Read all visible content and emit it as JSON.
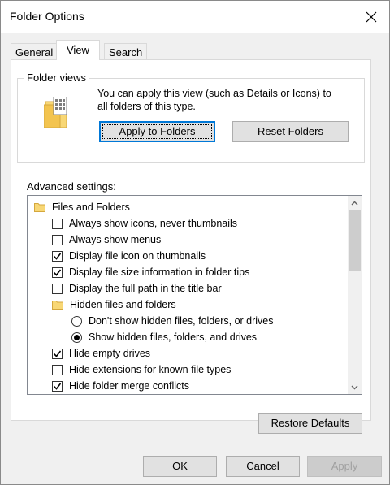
{
  "window": {
    "title": "Folder Options"
  },
  "tabs": [
    {
      "label": "General",
      "active": false
    },
    {
      "label": "View",
      "active": true
    },
    {
      "label": "Search",
      "active": false
    }
  ],
  "folder_views": {
    "legend": "Folder views",
    "description_line1": "You can apply this view (such as Details or Icons) to",
    "description_line2": "all folders of this type.",
    "apply_button": "Apply to Folders",
    "reset_button": "Reset Folders"
  },
  "advanced": {
    "label": "Advanced settings:",
    "items": [
      {
        "type": "folder",
        "label": "Files and Folders",
        "indent": 0
      },
      {
        "type": "checkbox",
        "label": "Always show icons, never thumbnails",
        "checked": false,
        "indent": 1
      },
      {
        "type": "checkbox",
        "label": "Always show menus",
        "checked": false,
        "indent": 1
      },
      {
        "type": "checkbox",
        "label": "Display file icon on thumbnails",
        "checked": true,
        "indent": 1
      },
      {
        "type": "checkbox",
        "label": "Display file size information in folder tips",
        "checked": true,
        "indent": 1
      },
      {
        "type": "checkbox",
        "label": "Display the full path in the title bar",
        "checked": false,
        "indent": 1
      },
      {
        "type": "folder",
        "label": "Hidden files and folders",
        "indent": 1
      },
      {
        "type": "radio",
        "label": "Don't show hidden files, folders, or drives",
        "checked": false,
        "indent": 2
      },
      {
        "type": "radio",
        "label": "Show hidden files, folders, and drives",
        "checked": true,
        "indent": 2
      },
      {
        "type": "checkbox",
        "label": "Hide empty drives",
        "checked": true,
        "indent": 1
      },
      {
        "type": "checkbox",
        "label": "Hide extensions for known file types",
        "checked": false,
        "indent": 1
      },
      {
        "type": "checkbox",
        "label": "Hide folder merge conflicts",
        "checked": true,
        "indent": 1
      }
    ]
  },
  "restore_defaults": "Restore Defaults",
  "footer": {
    "ok": "OK",
    "cancel": "Cancel",
    "apply": "Apply"
  },
  "colors": {
    "focus_border": "#0078d7",
    "folder_yellow": "#f8d775",
    "button_face": "#e1e1e1"
  }
}
